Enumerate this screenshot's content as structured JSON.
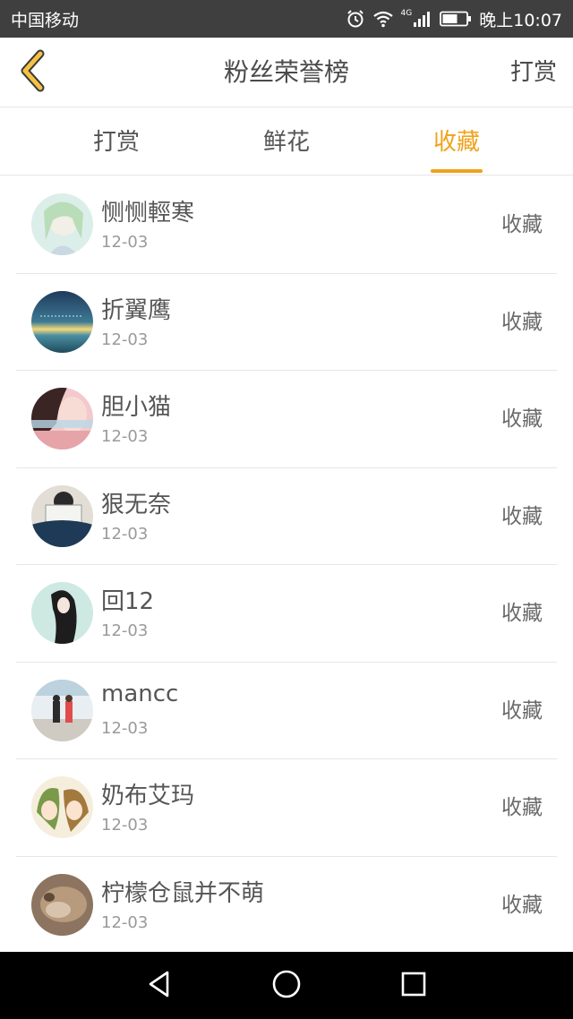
{
  "status_bar": {
    "carrier": "中国移动",
    "network": "4G",
    "time": "晚上10:07"
  },
  "header": {
    "back_icon": "chevron-left-icon",
    "title": "粉丝荣誉榜",
    "action_label": "打赏"
  },
  "tabs": [
    {
      "label": "打赏",
      "active": false
    },
    {
      "label": "鲜花",
      "active": false
    },
    {
      "label": "收藏",
      "active": true
    }
  ],
  "colors": {
    "accent": "#f0a21b",
    "status_bar_bg": "#3f3f3f",
    "nav_bar_bg": "#000000",
    "text_primary": "#555555",
    "text_secondary": "#9a9a9a",
    "divider": "#e6e6e6"
  },
  "list": {
    "items": [
      {
        "name": "恻恻輕寒",
        "date": "12-03",
        "action": "收藏"
      },
      {
        "name": "折翼鹰",
        "date": "12-03",
        "action": "收藏"
      },
      {
        "name": "胆小猫",
        "date": "12-03",
        "action": "收藏"
      },
      {
        "name": "狠无奈",
        "date": "12-03",
        "action": "收藏"
      },
      {
        "name": "回12",
        "date": "12-03",
        "action": "收藏"
      },
      {
        "name": "mancc",
        "date": "12-03",
        "action": "收藏"
      },
      {
        "name": "奶布艾玛",
        "date": "12-03",
        "action": "收藏"
      },
      {
        "name": "柠檬仓鼠并不萌",
        "date": "12-03",
        "action": "收藏"
      }
    ]
  },
  "nav_bar": {
    "icons": [
      "back-triangle-icon",
      "home-circle-icon",
      "recents-square-icon"
    ]
  }
}
